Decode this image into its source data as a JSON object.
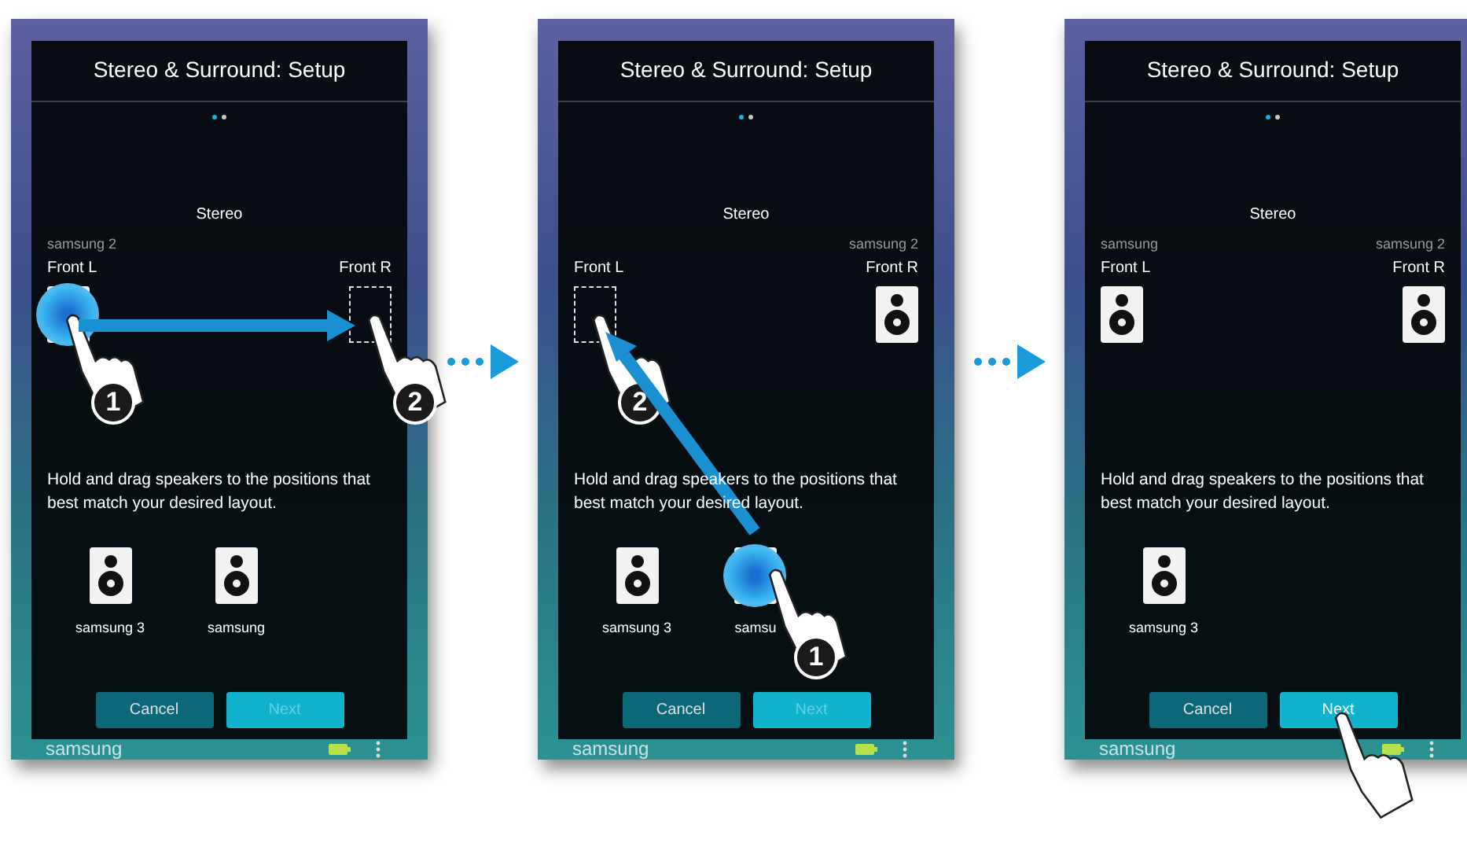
{
  "panels": [
    {
      "dialog_title": "Stereo & Surround: Setup",
      "page_dots": [
        {
          "selected": true
        },
        {
          "selected": false
        }
      ],
      "mode": "Stereo",
      "slots": [
        {
          "position": "Front L",
          "device": "samsung 2",
          "kind": "dragging",
          "touch": {
            "step": "1"
          }
        },
        {
          "position": "Front R",
          "kind": "empty",
          "touch": {
            "step": "2"
          }
        }
      ],
      "instruction": "Hold and drag speakers to the positions that best match your desired layout.",
      "pool": [
        {
          "name": "samsung 3",
          "kind": "idle"
        },
        {
          "name": "samsung",
          "kind": "idle"
        }
      ],
      "buttons": [
        {
          "label": "Cancel",
          "disabled": false
        },
        {
          "label": "Next",
          "disabled": true
        }
      ],
      "footer": "samsung",
      "drag_arrow": {
        "kind": "right"
      }
    },
    {
      "dialog_title": "Stereo & Surround: Setup",
      "page_dots": [
        {
          "selected": true
        },
        {
          "selected": false
        }
      ],
      "mode": "Stereo",
      "slots": [
        {
          "position": "Front L",
          "kind": "empty",
          "touch": {
            "step": "2"
          }
        },
        {
          "position": "Front R",
          "device": "samsung 2",
          "kind": "speaker"
        }
      ],
      "instruction": "Hold and drag speakers to the positions that best match your desired layout.",
      "pool": [
        {
          "name": "samsung 3",
          "kind": "idle"
        },
        {
          "name": "samsu",
          "kind": "dragging",
          "touch": {
            "step": "1"
          }
        }
      ],
      "buttons": [
        {
          "label": "Cancel",
          "disabled": false
        },
        {
          "label": "Next",
          "disabled": true
        }
      ],
      "footer": "samsung",
      "drag_arrow": {
        "kind": "up_left"
      }
    },
    {
      "dialog_title": "Stereo & Surround: Setup",
      "page_dots": [
        {
          "selected": true
        },
        {
          "selected": false
        }
      ],
      "mode": "Stereo",
      "slots": [
        {
          "position": "Front L",
          "device": "samsung",
          "kind": "speaker"
        },
        {
          "position": "Front R",
          "device": "samsung 2",
          "kind": "speaker"
        }
      ],
      "instruction": "Hold and drag speakers to the positions that best match your desired layout.",
      "pool": [
        {
          "name": "samsung 3",
          "kind": "idle"
        }
      ],
      "buttons": [
        {
          "label": "Cancel",
          "disabled": false
        },
        {
          "label": "Next",
          "disabled": false,
          "touched": true
        }
      ],
      "footer": "samsung"
    }
  ]
}
